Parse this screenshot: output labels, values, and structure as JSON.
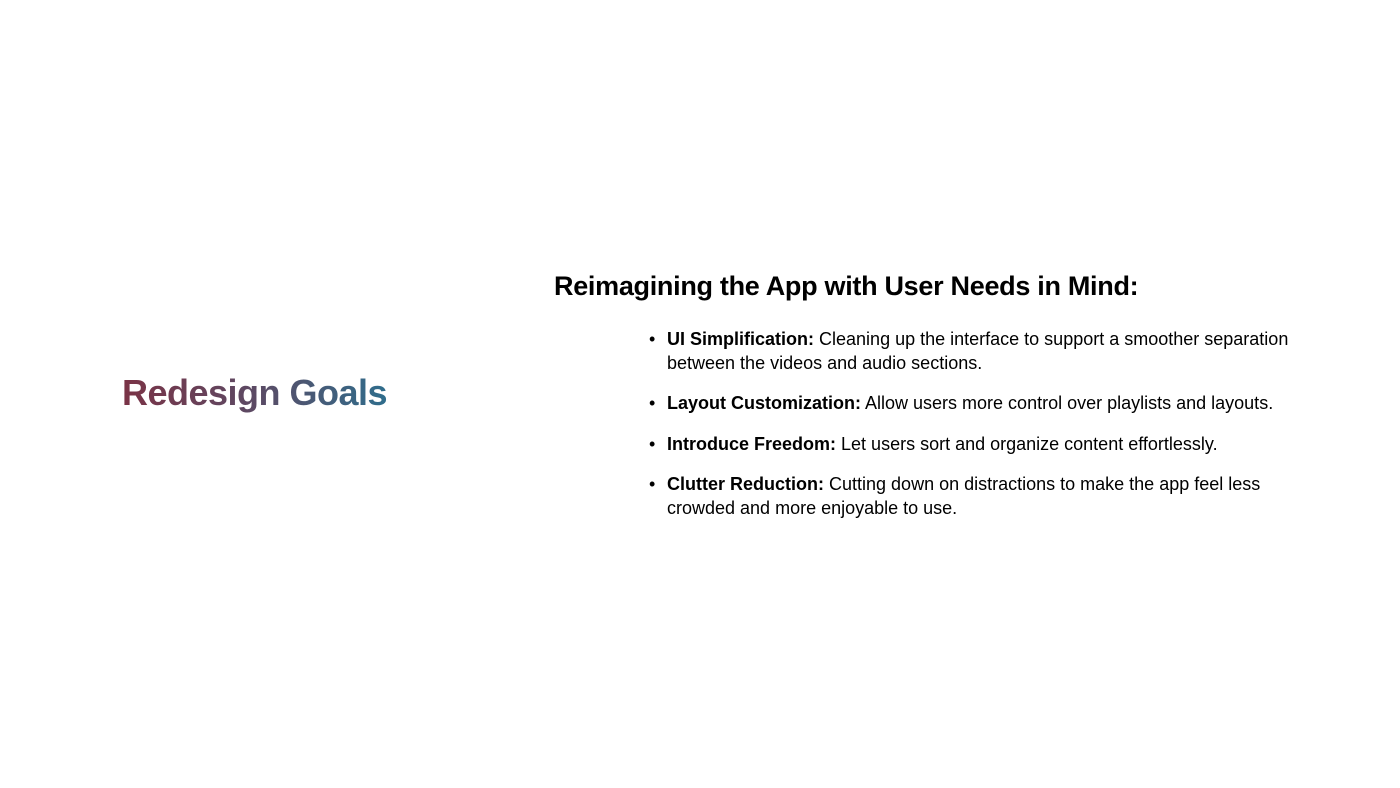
{
  "left": {
    "title": "Redesign Goals"
  },
  "main": {
    "heading": "Reimagining the App with User Needs in Mind:",
    "goals": [
      {
        "label": "UI Simplification:",
        "text": "Cleaning up the interface to support a smoother separation between the videos and audio sections."
      },
      {
        "label": "Layout Customization:",
        "text": "Allow users more control over playlists and layouts."
      },
      {
        "label": "Introduce Freedom:",
        "text": "Let users sort and organize content effortlessly."
      },
      {
        "label": "Clutter Reduction:",
        "text": "Cutting down on distractions to make the app feel less crowded and more enjoyable to use."
      }
    ]
  },
  "colors": {
    "title_gradient_start": "#7a3346",
    "title_gradient_end": "#2f6d8c",
    "text": "#000000",
    "background": "#ffffff"
  },
  "icons": {
    "bullet": "bullet-dot-icon"
  }
}
